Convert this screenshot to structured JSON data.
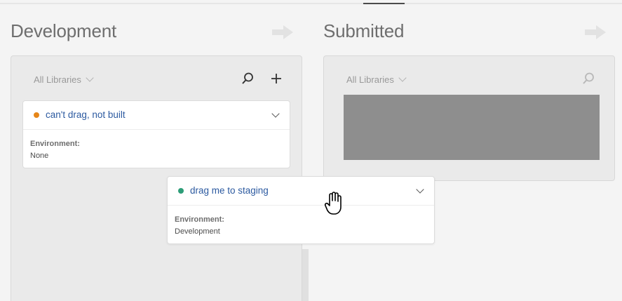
{
  "columns": [
    {
      "title": "Development",
      "library_select": "All Libraries",
      "cards": [
        {
          "title": "can't drag, not built",
          "status_color": "#e68619",
          "env_label": "Environment:",
          "env_value": "None"
        }
      ]
    },
    {
      "title": "Submitted",
      "library_select": "All Libraries"
    }
  ],
  "dragged_card": {
    "title": "drag me to staging",
    "status_color": "#2d9d78",
    "env_label": "Environment:",
    "env_value": "Development"
  },
  "icons": {
    "arrow": "arrow-right-icon",
    "search": "search-icon",
    "add": "plus-icon",
    "chevron": "chevron-down-icon",
    "cursor": "hand-grab-cursor-icon"
  }
}
